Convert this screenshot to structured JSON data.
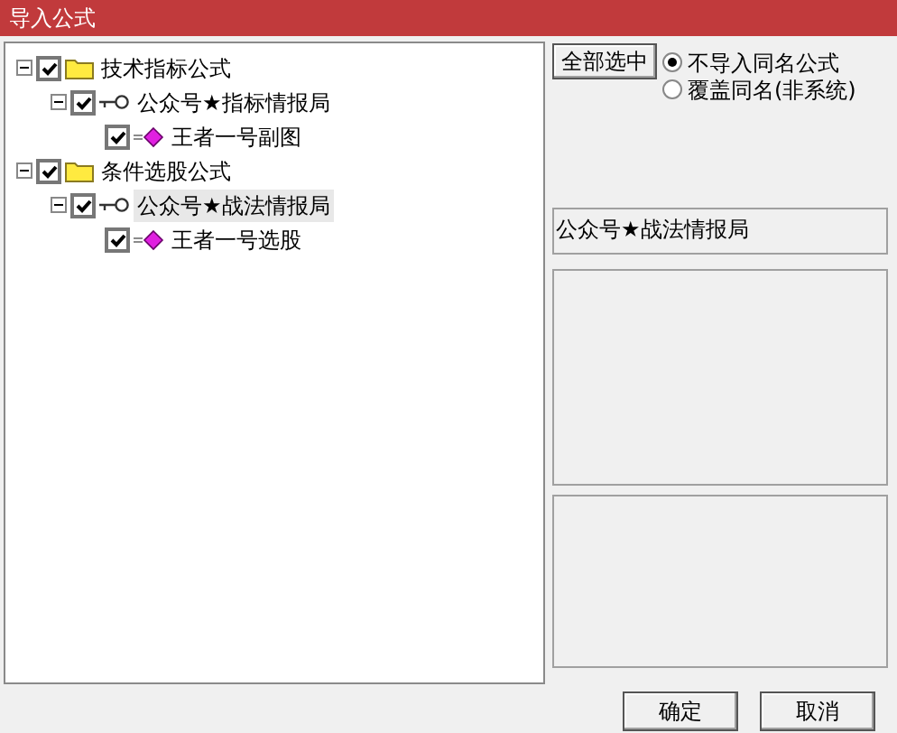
{
  "window": {
    "title": "导入公式"
  },
  "tree": [
    {
      "kind": "folder",
      "label": "技术指标公式",
      "checked": true,
      "expanded": true,
      "selected": false,
      "children": [
        {
          "kind": "formula",
          "label": "公众号★指标情报局",
          "checked": true,
          "expanded": true,
          "selected": false,
          "children": [
            {
              "kind": "indicator",
              "label": "王者一号副图",
              "checked": true,
              "selected": false
            }
          ]
        }
      ]
    },
    {
      "kind": "folder",
      "label": "条件选股公式",
      "checked": true,
      "expanded": true,
      "selected": false,
      "children": [
        {
          "kind": "formula",
          "label": "公众号★战法情报局",
          "checked": true,
          "expanded": true,
          "selected": true,
          "children": [
            {
              "kind": "indicator",
              "label": "王者一号选股",
              "checked": true,
              "selected": false
            }
          ]
        }
      ]
    }
  ],
  "select_all_button": "全部选中",
  "options": [
    {
      "label": "不导入同名公式",
      "selected": true
    },
    {
      "label": "覆盖同名(非系统)",
      "selected": false
    }
  ],
  "detail": {
    "name": "公众号★战法情报局"
  },
  "buttons": [
    "确定",
    "取消"
  ]
}
